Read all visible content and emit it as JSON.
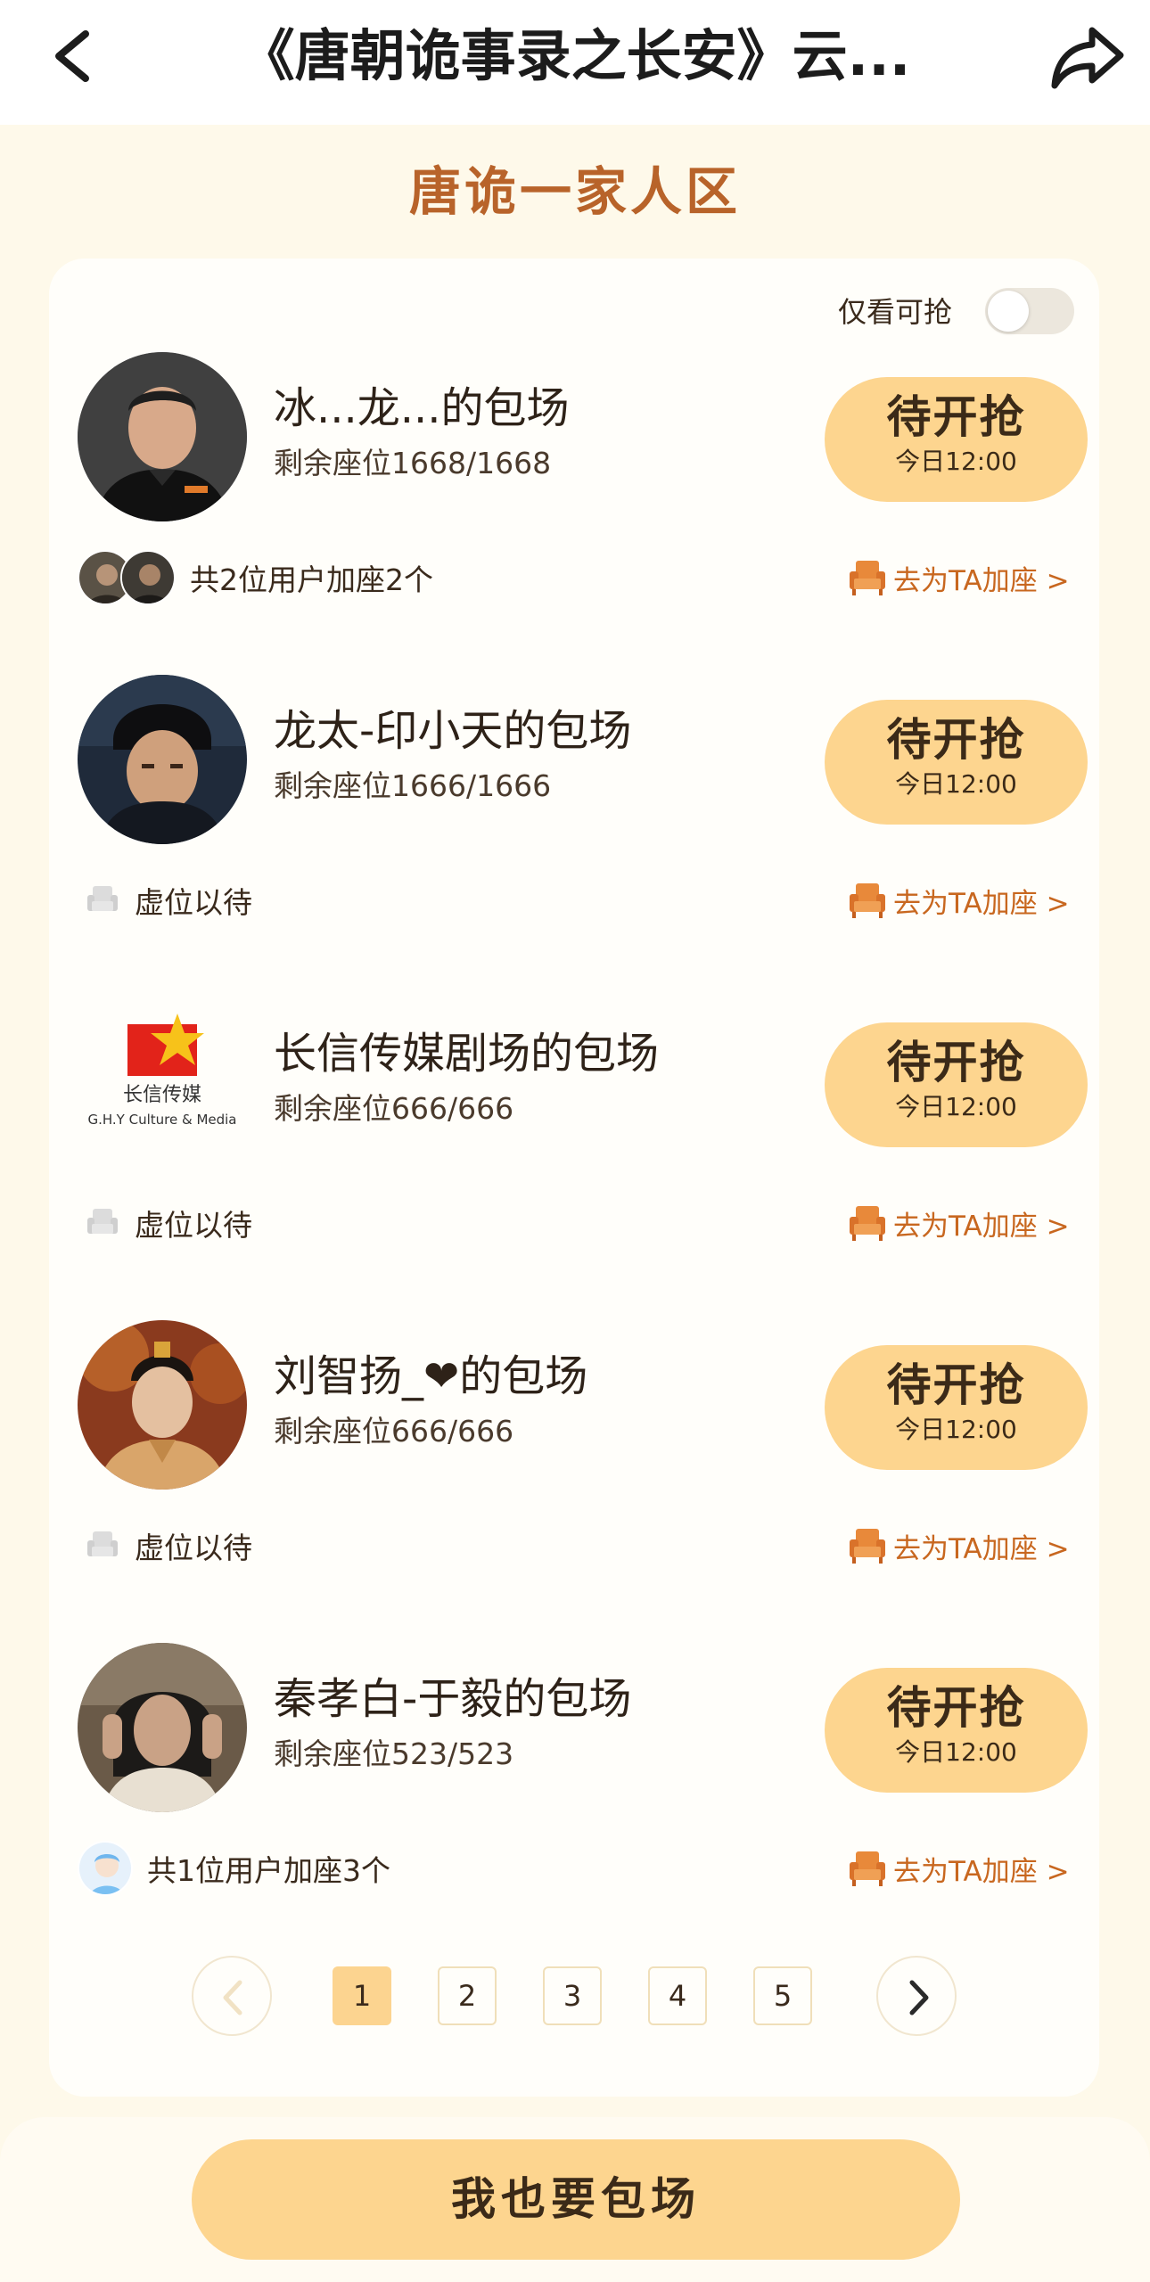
{
  "header": {
    "title": "《唐朝诡事录之长安》云...",
    "back_icon": "chevron-left-icon",
    "share_icon": "share-arrow-icon"
  },
  "section": {
    "title": "唐诡一家人区"
  },
  "filter": {
    "label": "仅看可抢",
    "enabled": false
  },
  "entries": [
    {
      "name": "冰...龙...的包场",
      "seats": "剩余座位1668/1668",
      "button": {
        "label": "待开抢",
        "time": "今日12:00"
      },
      "footer": {
        "type": "joined",
        "text": "共2位用户加座2个"
      },
      "link": "去为TA加座 >"
    },
    {
      "name": "龙太-印小天的包场",
      "seats": "剩余座位1666/1666",
      "button": {
        "label": "待开抢",
        "time": "今日12:00"
      },
      "footer": {
        "type": "empty",
        "text": "虚位以待"
      },
      "link": "去为TA加座 >"
    },
    {
      "name": "长信传媒剧场的包场",
      "seats": "剩余座位666/666",
      "button": {
        "label": "待开抢",
        "time": "今日12:00"
      },
      "footer": {
        "type": "empty",
        "text": "虚位以待"
      },
      "link": "去为TA加座 >",
      "logo": {
        "cn": "长信传媒",
        "en": "G.H.Y Culture & Media"
      }
    },
    {
      "name": "刘智扬_❤的包场",
      "seats": "剩余座位666/666",
      "button": {
        "label": "待开抢",
        "time": "今日12:00"
      },
      "footer": {
        "type": "empty",
        "text": "虚位以待"
      },
      "link": "去为TA加座 >"
    },
    {
      "name": "秦孝白-于毅的包场",
      "seats": "剩余座位523/523",
      "button": {
        "label": "待开抢",
        "time": "今日12:00"
      },
      "footer": {
        "type": "joined",
        "text": "共1位用户加座3个"
      },
      "link": "去为TA加座 >"
    }
  ],
  "pagination": {
    "pages": [
      "1",
      "2",
      "3",
      "4",
      "5"
    ],
    "current": "1"
  },
  "bottom": {
    "button": "我也要包场"
  },
  "colors": {
    "accent": "#fdd58f",
    "link": "#c8671f",
    "title": "#b8632a",
    "background": "#fef9ea"
  }
}
